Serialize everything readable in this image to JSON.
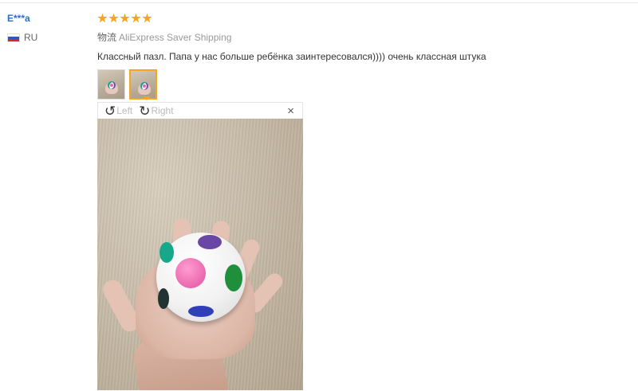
{
  "user": {
    "name": "E***a",
    "country_code": "RU",
    "flag_colors": [
      "#ffffff",
      "#2c58c2",
      "#d52b1e"
    ]
  },
  "review": {
    "rating": 5,
    "max_rating": 5,
    "star_color": "#f4a623",
    "shipping_label": "物流",
    "shipping_method": "AliExpress Saver Shipping",
    "text": "Классный пазл. Папа у нас больше ребёнка заинтересовался)))) очень классная штука"
  },
  "thumbnails": [
    {
      "name": "review-photo-1",
      "active": false
    },
    {
      "name": "review-photo-2",
      "active": true
    }
  ],
  "viewer": {
    "rotate_left_label": "Left",
    "rotate_right_label": "Right",
    "close_symbol": "×",
    "rotate_left_icon": "rotate-left-icon",
    "rotate_right_icon": "rotate-right-icon"
  },
  "colors": {
    "username": "#2a6fc4",
    "accent": "#f4a623"
  }
}
